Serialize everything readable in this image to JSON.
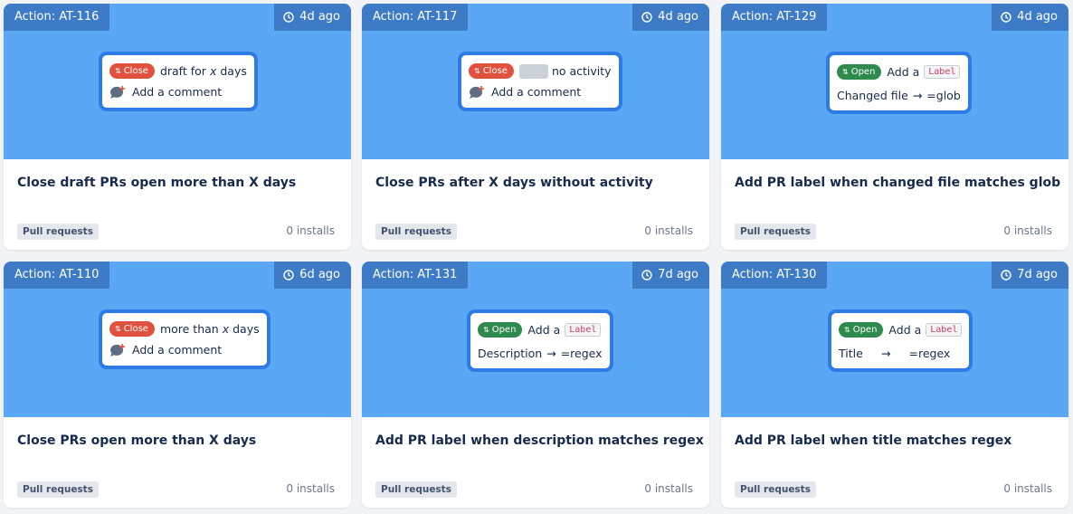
{
  "colors": {
    "banner": "#5aa7f5",
    "tag": "#3e7bc6",
    "close_pill": "#e0513f",
    "open_pill": "#2f8a4e",
    "preview_border": "#2d7be5"
  },
  "cards": [
    {
      "action": "Action: AT-116",
      "time": "4d ago",
      "pill": "Close",
      "line1_text": "draft for",
      "line1_var": "x",
      "line1_suffix": "days",
      "line2": "Add a comment",
      "title": "Close draft PRs open more than X days",
      "category": "Pull requests",
      "installs": "0 installs"
    },
    {
      "action": "Action: AT-117",
      "time": "4d ago",
      "pill": "Close",
      "line1_text": "no activity",
      "line2": "Add a comment",
      "title": "Close PRs after X days without activity",
      "category": "Pull requests",
      "installs": "0 installs"
    },
    {
      "action": "Action: AT-129",
      "time": "4d ago",
      "pill": "Open",
      "line1_text": "Add a",
      "label": "Label",
      "line2_left": "Changed file",
      "arrow": "→",
      "line2_right": "=glob",
      "title": "Add PR label when changed file matches glob",
      "category": "Pull requests",
      "installs": "0 installs"
    },
    {
      "action": "Action: AT-110",
      "time": "6d ago",
      "pill": "Close",
      "line1_text": "more than",
      "line1_var": "x",
      "line1_suffix": "days",
      "line2": "Add a comment",
      "title": "Close PRs open more than X days",
      "category": "Pull requests",
      "installs": "0 installs"
    },
    {
      "action": "Action: AT-131",
      "time": "7d ago",
      "pill": "Open",
      "line1_text": "Add a",
      "label": "Label",
      "line2_left": "Description",
      "arrow": "→",
      "line2_right": "=regex",
      "title": "Add PR label when description matches regex",
      "category": "Pull requests",
      "installs": "0 installs"
    },
    {
      "action": "Action: AT-130",
      "time": "7d ago",
      "pill": "Open",
      "line1_text": "Add a",
      "label": "Label",
      "line2_left": "Title",
      "arrow": "→",
      "line2_right": "=regex",
      "title": "Add PR label when title matches regex",
      "category": "Pull requests",
      "installs": "0 installs"
    }
  ]
}
